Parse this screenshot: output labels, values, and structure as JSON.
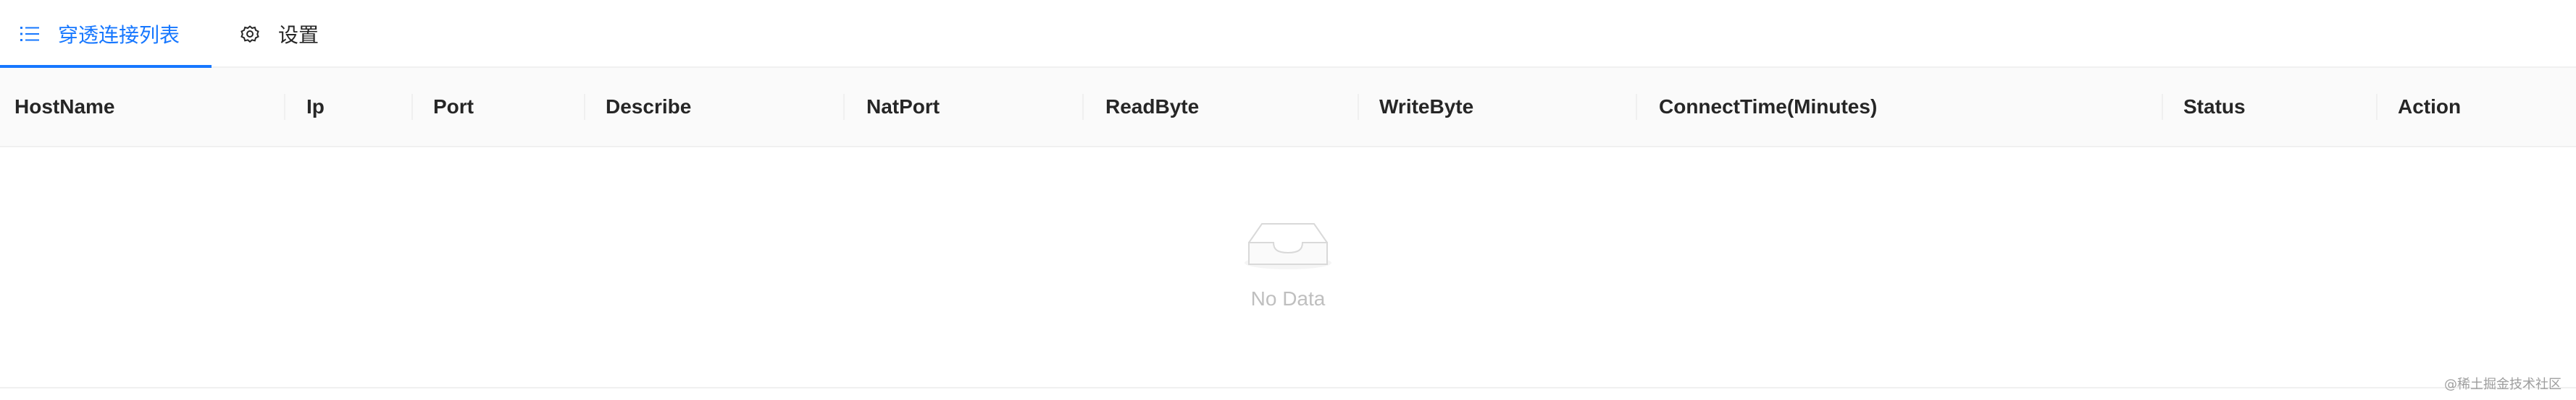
{
  "tabs": [
    {
      "label": "穿透连接列表",
      "icon": "unordered-list-icon",
      "active": true
    },
    {
      "label": "设置",
      "icon": "gear-icon",
      "active": false
    }
  ],
  "table": {
    "columns": [
      "HostName",
      "Ip",
      "Port",
      "Describe",
      "NatPort",
      "ReadByte",
      "WriteByte",
      "ConnectTime(Minutes)",
      "Status",
      "Action"
    ],
    "rows": [],
    "empty_text": "No Data"
  },
  "watermark": "@稀土掘金技术社区",
  "colors": {
    "accent": "#1677ff",
    "header_bg": "#fafafa",
    "border": "#f0f0f0",
    "muted_text": "#bfbfbf"
  }
}
